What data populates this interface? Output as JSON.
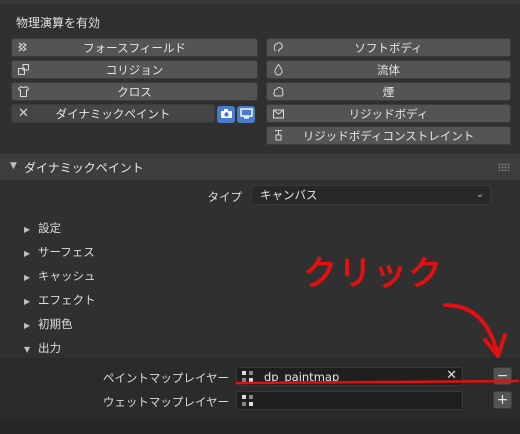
{
  "physics": {
    "title": "物理演算を有効",
    "left_buttons": [
      {
        "label": "フォースフィールド",
        "icon": "force-field-icon"
      },
      {
        "label": "コリジョン",
        "icon": "collision-icon"
      },
      {
        "label": "クロス",
        "icon": "cloth-icon"
      },
      {
        "label": "ダイナミックペイント",
        "icon": "close-icon",
        "active": true
      }
    ],
    "right_buttons": [
      {
        "label": "ソフトボディ",
        "icon": "soft-body-icon"
      },
      {
        "label": "流体",
        "icon": "fluid-icon"
      },
      {
        "label": "煙",
        "icon": "smoke-icon"
      },
      {
        "label": "リジッドボディ",
        "icon": "rigid-body-icon"
      },
      {
        "label": "リジッドボディコンストレイント",
        "icon": "rigid-body-constraint-icon"
      }
    ],
    "toggle_icons": [
      "camera-icon",
      "monitor-icon"
    ]
  },
  "panel": {
    "title": "ダイナミックペイント",
    "type_label": "タイプ",
    "type_value": "キャンバス",
    "subpanels": [
      "設定",
      "サーフェス",
      "キャッシュ",
      "エフェクト",
      "初期色",
      "出力"
    ],
    "output": {
      "paintmap_label": "ペイントマップレイヤー",
      "paintmap_value": "dp_paintmap",
      "wetmap_label": "ウェットマップレイヤー",
      "wetmap_value": "",
      "minus_label": "−",
      "plus_label": "+"
    }
  },
  "annotation": {
    "text": "クリック",
    "color": "#e21010"
  },
  "colors": {
    "background": "#303030",
    "button": "#545454",
    "accent_blue": "#4a7ccb",
    "annotation_red": "#e21010"
  }
}
